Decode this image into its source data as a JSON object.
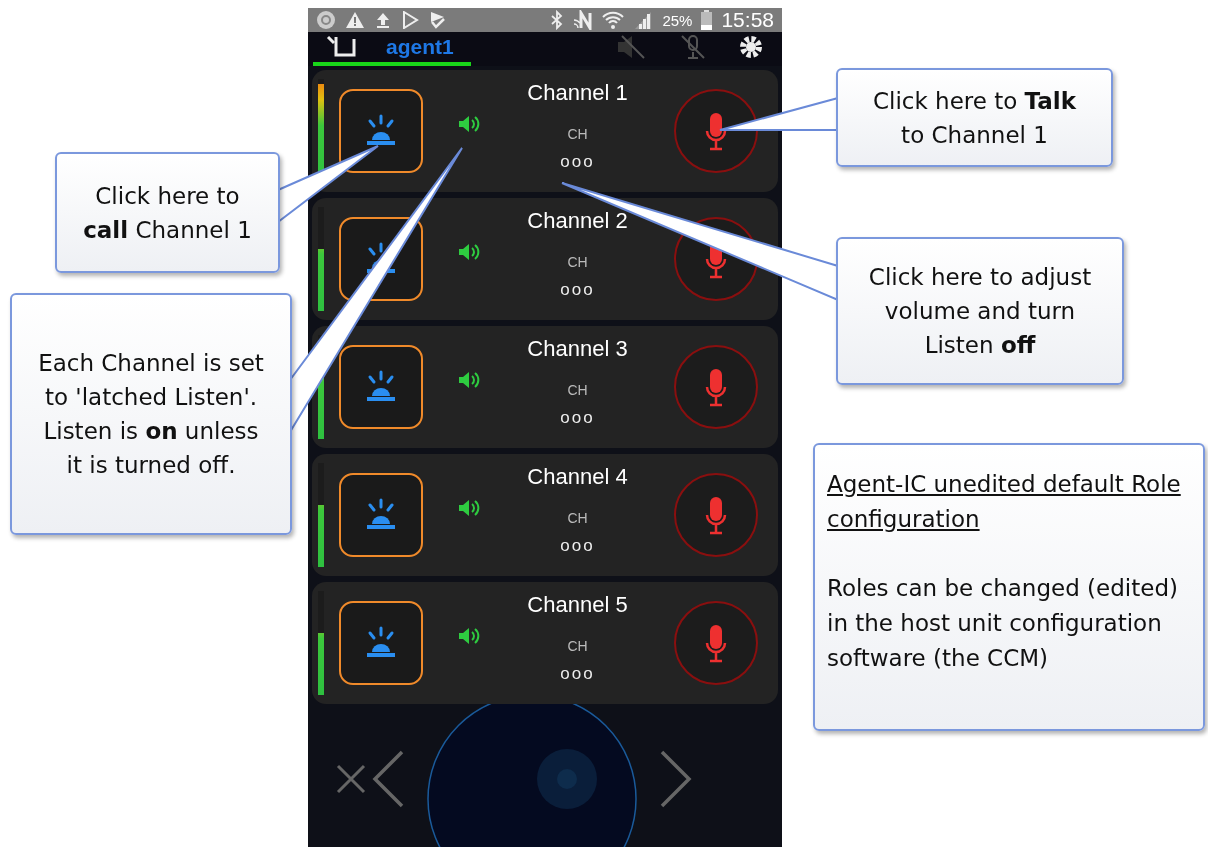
{
  "status_bar": {
    "battery": "25%",
    "time": "15:58"
  },
  "header": {
    "title": "agent1"
  },
  "channels": [
    {
      "name": "Channel 1",
      "label": "CH",
      "dots": "ooo",
      "level": 0.95,
      "listen": true
    },
    {
      "name": "Channel 2",
      "label": "CH",
      "dots": "ooo",
      "level": 0.6,
      "listen": true
    },
    {
      "name": "Channel 3",
      "label": "CH",
      "dots": "ooo",
      "level": 0.6,
      "listen": true
    },
    {
      "name": "Channel 4",
      "label": "CH",
      "dots": "ooo",
      "level": 0.6,
      "listen": true
    },
    {
      "name": "Channel 5",
      "label": "CH",
      "dots": "ooo",
      "level": 0.6,
      "listen": true
    }
  ],
  "callouts": [
    {
      "text": "Click here to **call** Channel 1"
    },
    {
      "text": "Each Channel is set to 'latched Listen'. Listen is **on** unless it is turned off."
    },
    {
      "text": "Click here to **Talk** to Channel 1"
    },
    {
      "text": "Click here to adjust volume and turn Listen **off**"
    }
  ],
  "note": {
    "title": "Agent-IC unedited default Role configuration",
    "body": "Roles can be changed (edited) in the host unit configuration software (the CCM)"
  }
}
